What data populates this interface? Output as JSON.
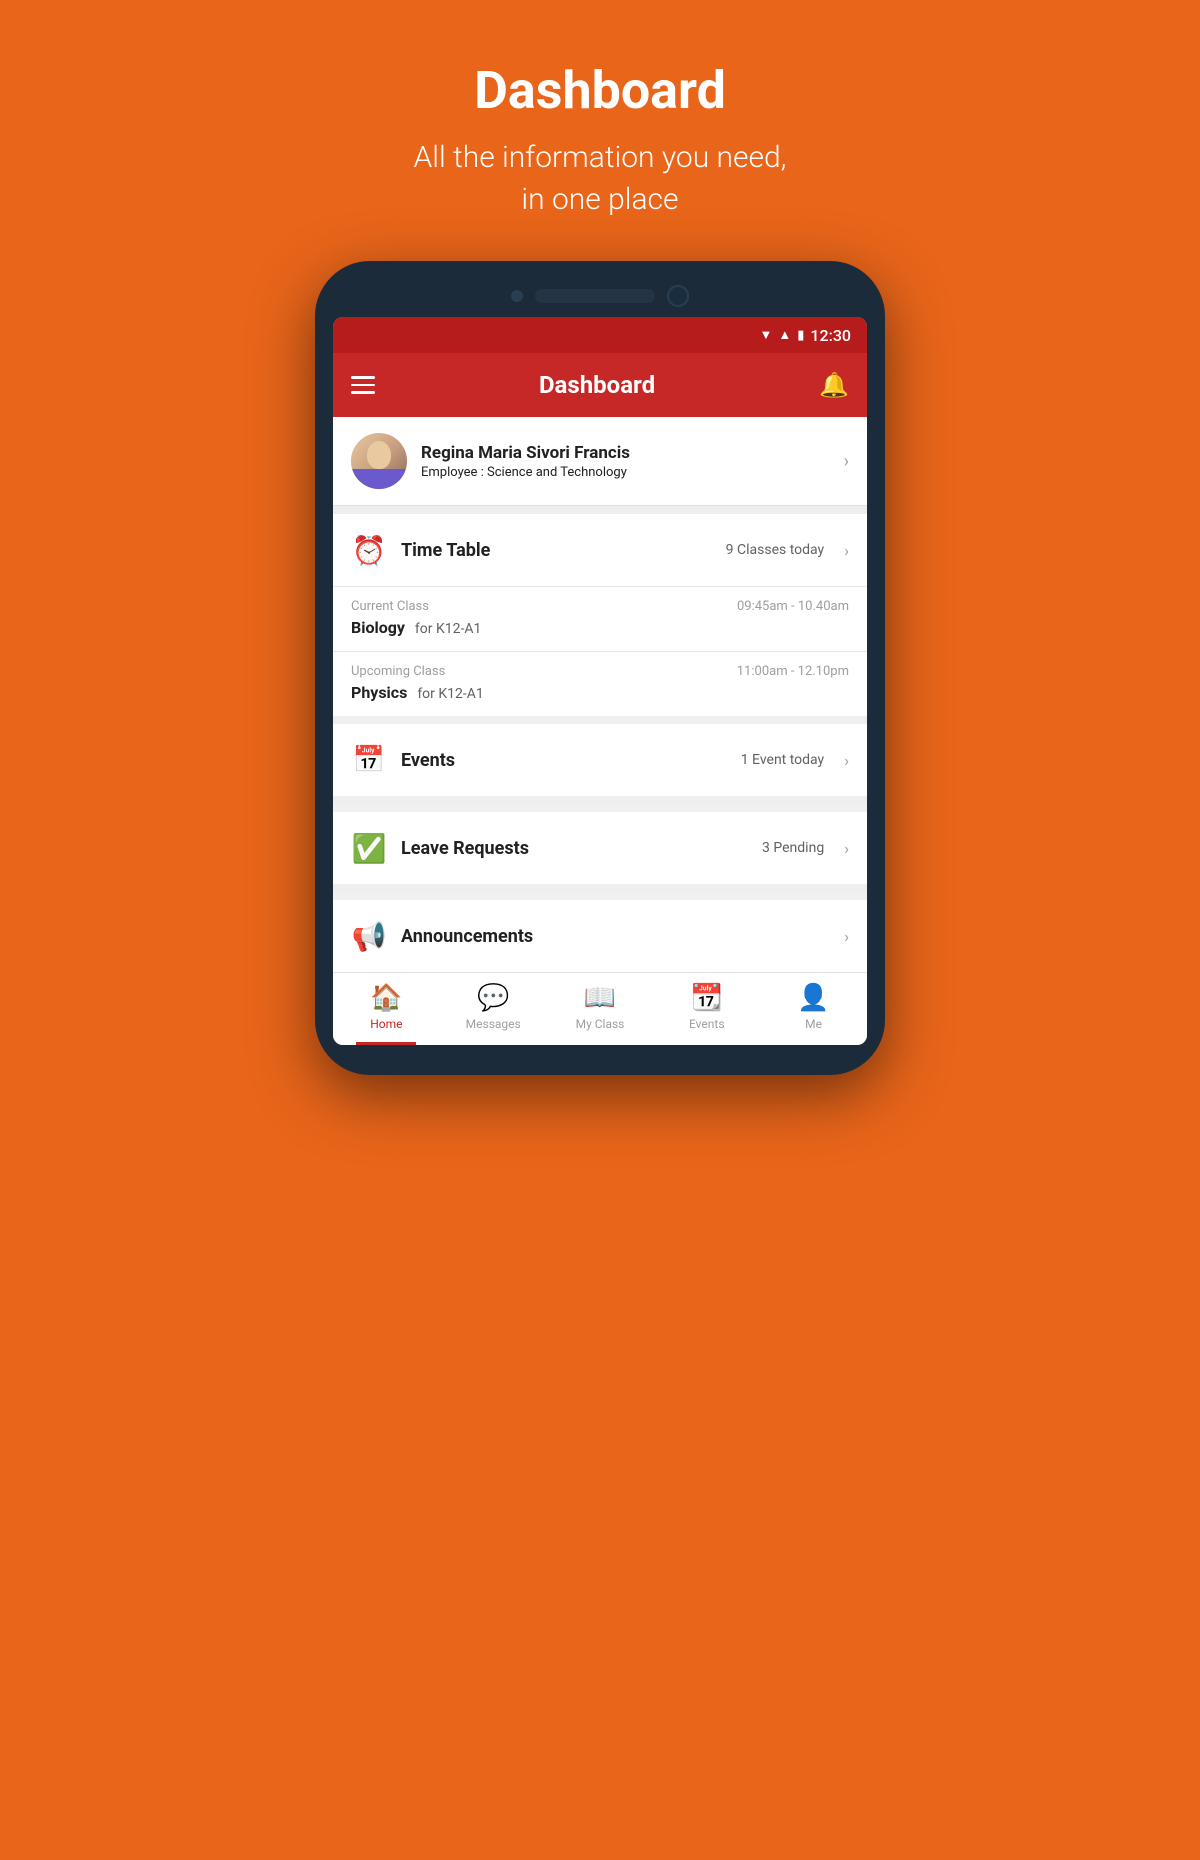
{
  "page": {
    "title": "Dashboard",
    "subtitle_line1": "All the information you need,",
    "subtitle_line2": "in one place"
  },
  "status_bar": {
    "time": "12:30"
  },
  "app_bar": {
    "title": "Dashboard"
  },
  "profile": {
    "name": "Regina Maria Sivori Francis",
    "role_label": "Employee : ",
    "role_value": "Science and Technology"
  },
  "timetable": {
    "label": "Time Table",
    "badge": "9 Classes today",
    "current_class": {
      "meta_label": "Current Class",
      "time": "09:45am - 10.40am",
      "subject": "Biology",
      "group": "for K12-A1"
    },
    "upcoming_class": {
      "meta_label": "Upcoming Class",
      "time": "11:00am - 12.10pm",
      "subject": "Physics",
      "group": "for K12-A1"
    }
  },
  "events": {
    "label": "Events",
    "badge": "1 Event today"
  },
  "leave_requests": {
    "label": "Leave Requests",
    "badge": "3 Pending"
  },
  "announcements": {
    "label": "Announcements"
  },
  "bottom_nav": {
    "items": [
      {
        "id": "home",
        "label": "Home",
        "active": true
      },
      {
        "id": "messages",
        "label": "Messages",
        "active": false
      },
      {
        "id": "myclass",
        "label": "My Class",
        "active": false
      },
      {
        "id": "events",
        "label": "Events",
        "active": false
      },
      {
        "id": "me",
        "label": "Me",
        "active": false
      }
    ]
  }
}
